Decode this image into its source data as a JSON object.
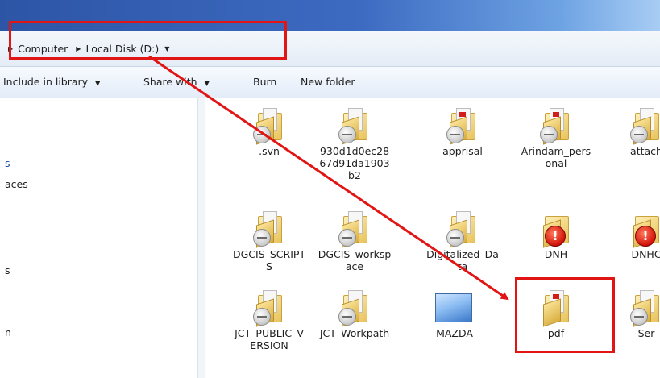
{
  "address_bar": {
    "crumbs": [
      "Computer",
      "Local Disk (D:)"
    ]
  },
  "toolbar": {
    "include_label": "Include in library",
    "share_label": "Share with",
    "burn_label": "Burn",
    "new_folder_label": "New folder"
  },
  "nav_pane": {
    "items": [
      {
        "text": "s",
        "link": true
      },
      {
        "text": "aces",
        "link": false
      },
      {
        "text": "s",
        "link": false
      },
      {
        "text": "n",
        "link": false
      }
    ]
  },
  "folders": [
    {
      "name": ".svn",
      "icon": "folder-sync-icon"
    },
    {
      "name": "930d1d0ec2867d91da1903b2",
      "icon": "folder-sync-icon"
    },
    {
      "name": "apprisal",
      "icon": "folder-sync-icon"
    },
    {
      "name": "Arindam_personal",
      "icon": "folder-sync-icon"
    },
    {
      "name": "attach",
      "icon": "folder-sync-icon"
    },
    {
      "name": "DGCIS_SCRIPTS",
      "icon": "folder-sync-icon"
    },
    {
      "name": "DGCIS_workspace",
      "icon": "folder-sync-icon"
    },
    {
      "name": "Digitalized_Data",
      "icon": "folder-sync-icon"
    },
    {
      "name": "DNH",
      "icon": "folder-warning-icon"
    },
    {
      "name": "DNHC",
      "icon": "folder-warning-icon"
    },
    {
      "name": "JCT_PUBLIC_VERSION",
      "icon": "folder-sync-icon"
    },
    {
      "name": "JCT_Workpath",
      "icon": "folder-sync-icon"
    },
    {
      "name": "MAZDA",
      "icon": "image-thumbnail-icon"
    },
    {
      "name": "pdf",
      "icon": "folder-pdf-icon"
    },
    {
      "name": "Ser",
      "icon": "folder-sync-icon"
    }
  ],
  "colors": {
    "highlight": "#e21515",
    "title_bar": "#2d55a6"
  }
}
